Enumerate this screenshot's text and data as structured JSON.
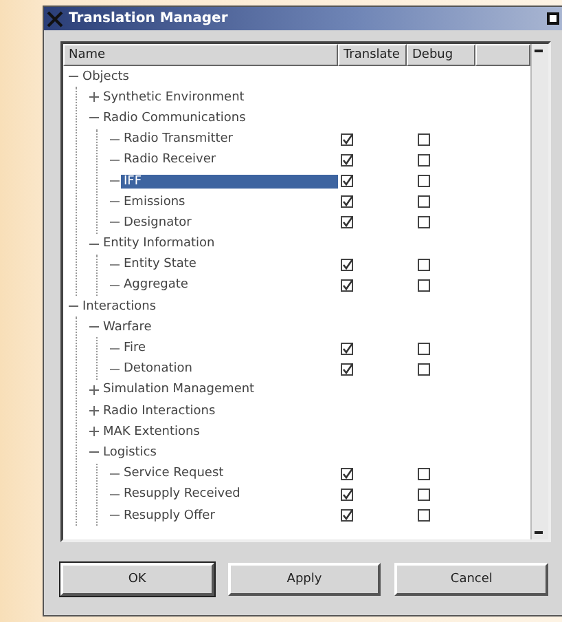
{
  "window": {
    "title": "Translation Manager"
  },
  "table": {
    "columns": [
      "Name",
      "Translate",
      "Debug"
    ],
    "rows": [
      {
        "name": "Objects",
        "expanded": true,
        "children": [
          {
            "name": "Synthetic Environment",
            "expanded": false
          },
          {
            "name": "Radio Communications",
            "expanded": true,
            "children": [
              {
                "name": "Radio Transmitter",
                "selected": false,
                "translate": true,
                "debug": false
              },
              {
                "name": "Radio Receiver",
                "selected": false,
                "translate": true,
                "debug": false
              },
              {
                "name": "IFF",
                "selected": true,
                "translate": true,
                "debug": false
              },
              {
                "name": "Emissions",
                "selected": false,
                "translate": true,
                "debug": false
              },
              {
                "name": "Designator",
                "selected": false,
                "translate": true,
                "debug": false
              }
            ]
          },
          {
            "name": "Entity Information",
            "expanded": true,
            "children": [
              {
                "name": "Entity State",
                "selected": false,
                "translate": true,
                "debug": false
              },
              {
                "name": "Aggregate",
                "selected": false,
                "translate": true,
                "debug": false
              }
            ]
          }
        ]
      },
      {
        "name": "Interactions",
        "expanded": true,
        "children": [
          {
            "name": "Warfare",
            "expanded": true,
            "children": [
              {
                "name": "Fire",
                "selected": false,
                "translate": true,
                "debug": false
              },
              {
                "name": "Detonation",
                "selected": false,
                "translate": true,
                "debug": false
              }
            ]
          },
          {
            "name": "Simulation Management",
            "expanded": false
          },
          {
            "name": "Radio Interactions",
            "expanded": false
          },
          {
            "name": "MAK Extentions",
            "expanded": false
          },
          {
            "name": "Logistics",
            "expanded": true,
            "children": [
              {
                "name": "Service Request",
                "selected": false,
                "translate": true,
                "debug": false
              },
              {
                "name": "Resupply Received",
                "selected": false,
                "translate": true,
                "debug": false
              },
              {
                "name": "Resupply Offer",
                "selected": false,
                "translate": true,
                "debug": false
              }
            ]
          }
        ]
      }
    ]
  },
  "buttons": [
    "OK",
    "Apply",
    "Cancel"
  ]
}
